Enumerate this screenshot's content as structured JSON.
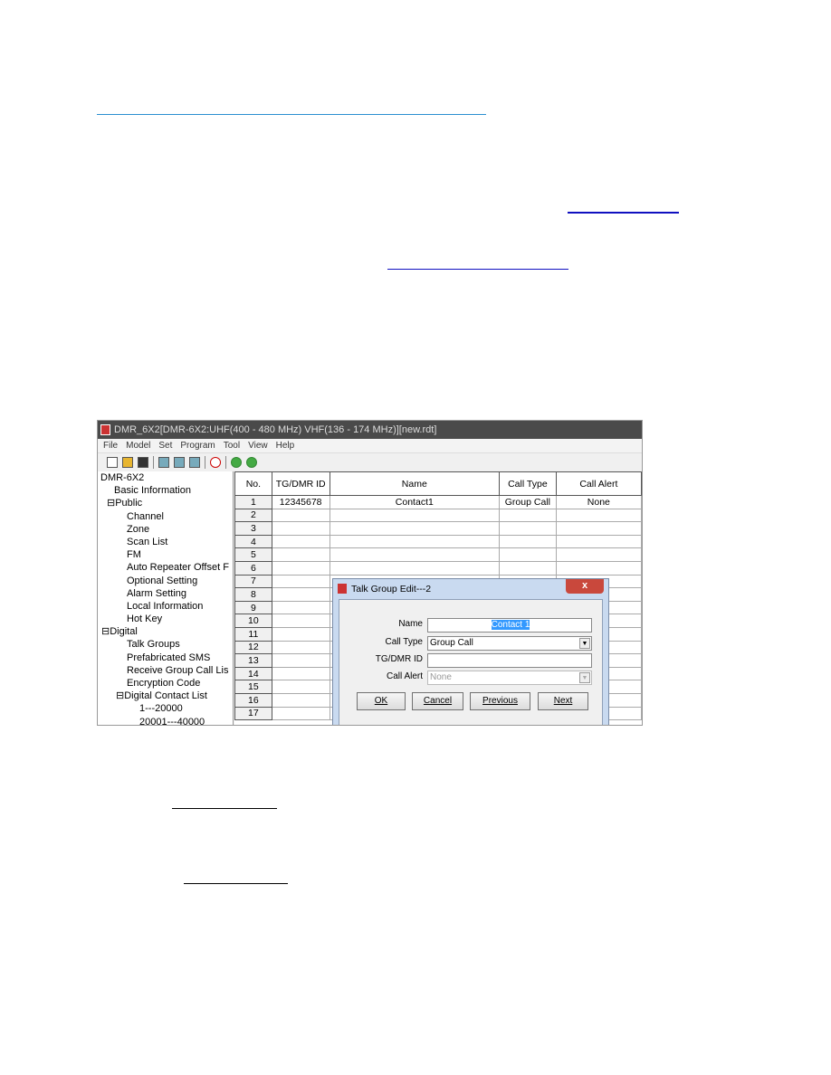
{
  "links": [
    "",
    "",
    "",
    "",
    ""
  ],
  "app": {
    "title": "DMR_6X2[DMR-6X2:UHF(400 - 480 MHz) VHF(136 - 174 MHz)][new.rdt]",
    "menu": [
      "File",
      "Model",
      "Set",
      "Program",
      "Tool",
      "View",
      "Help"
    ],
    "tree": [
      "DMR-6X2",
      "Basic Information",
      "Public",
      "Channel",
      "Zone",
      "Scan List",
      "FM",
      "Auto Repeater Offset F",
      "Optional Setting",
      "Alarm Setting",
      "Local Information",
      "Hot Key",
      "Digital",
      "Talk Groups",
      "Prefabricated SMS",
      "Receive Group Call Lis",
      "Encryption Code",
      "Digital Contact List",
      "1---20000",
      "20001---40000"
    ],
    "table": {
      "headers": [
        "No.",
        "TG/DMR ID",
        "Name",
        "Call Type",
        "Call Alert"
      ],
      "rows": [
        [
          "1",
          "12345678",
          "Contact1",
          "Group Call",
          "None"
        ],
        [
          "2"
        ],
        [
          "3"
        ],
        [
          "4"
        ],
        [
          "5"
        ],
        [
          "6"
        ],
        [
          "7"
        ],
        [
          "8"
        ],
        [
          "9"
        ],
        [
          "10"
        ],
        [
          "11"
        ],
        [
          "12"
        ],
        [
          "13"
        ],
        [
          "14"
        ],
        [
          "15"
        ],
        [
          "16"
        ],
        [
          "17"
        ]
      ]
    },
    "dialog": {
      "title": "Talk Group Edit---2",
      "close": "x",
      "name_label": "Name",
      "name_value": "Contact 1",
      "call_type_label": "Call Type",
      "call_type_value": "Group Call",
      "tg_label": "TG/DMR ID",
      "tg_value": "",
      "call_alert_label": "Call Alert",
      "call_alert_value": "None",
      "ok": "OK",
      "cancel": "Cancel",
      "previous": "Previous",
      "next": "Next"
    }
  },
  "colors": {
    "link": "#1010c0",
    "link_light": "#2a8fd0",
    "selection": "#3399ff"
  }
}
